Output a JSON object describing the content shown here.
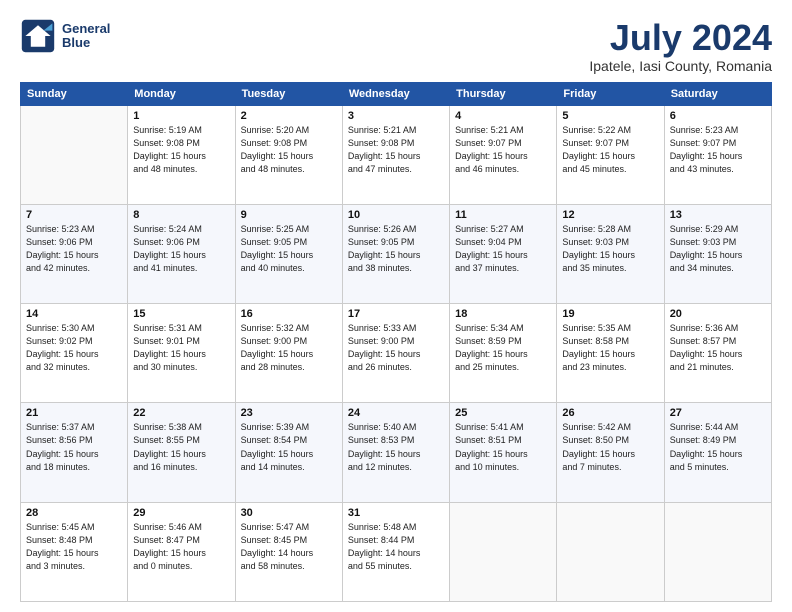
{
  "header": {
    "logo_line1": "General",
    "logo_line2": "Blue",
    "title": "July 2024",
    "subtitle": "Ipatele, Iasi County, Romania"
  },
  "weekdays": [
    "Sunday",
    "Monday",
    "Tuesday",
    "Wednesday",
    "Thursday",
    "Friday",
    "Saturday"
  ],
  "weeks": [
    [
      {
        "day": "",
        "detail": ""
      },
      {
        "day": "1",
        "detail": "Sunrise: 5:19 AM\nSunset: 9:08 PM\nDaylight: 15 hours\nand 48 minutes."
      },
      {
        "day": "2",
        "detail": "Sunrise: 5:20 AM\nSunset: 9:08 PM\nDaylight: 15 hours\nand 48 minutes."
      },
      {
        "day": "3",
        "detail": "Sunrise: 5:21 AM\nSunset: 9:08 PM\nDaylight: 15 hours\nand 47 minutes."
      },
      {
        "day": "4",
        "detail": "Sunrise: 5:21 AM\nSunset: 9:07 PM\nDaylight: 15 hours\nand 46 minutes."
      },
      {
        "day": "5",
        "detail": "Sunrise: 5:22 AM\nSunset: 9:07 PM\nDaylight: 15 hours\nand 45 minutes."
      },
      {
        "day": "6",
        "detail": "Sunrise: 5:23 AM\nSunset: 9:07 PM\nDaylight: 15 hours\nand 43 minutes."
      }
    ],
    [
      {
        "day": "7",
        "detail": "Sunrise: 5:23 AM\nSunset: 9:06 PM\nDaylight: 15 hours\nand 42 minutes."
      },
      {
        "day": "8",
        "detail": "Sunrise: 5:24 AM\nSunset: 9:06 PM\nDaylight: 15 hours\nand 41 minutes."
      },
      {
        "day": "9",
        "detail": "Sunrise: 5:25 AM\nSunset: 9:05 PM\nDaylight: 15 hours\nand 40 minutes."
      },
      {
        "day": "10",
        "detail": "Sunrise: 5:26 AM\nSunset: 9:05 PM\nDaylight: 15 hours\nand 38 minutes."
      },
      {
        "day": "11",
        "detail": "Sunrise: 5:27 AM\nSunset: 9:04 PM\nDaylight: 15 hours\nand 37 minutes."
      },
      {
        "day": "12",
        "detail": "Sunrise: 5:28 AM\nSunset: 9:03 PM\nDaylight: 15 hours\nand 35 minutes."
      },
      {
        "day": "13",
        "detail": "Sunrise: 5:29 AM\nSunset: 9:03 PM\nDaylight: 15 hours\nand 34 minutes."
      }
    ],
    [
      {
        "day": "14",
        "detail": "Sunrise: 5:30 AM\nSunset: 9:02 PM\nDaylight: 15 hours\nand 32 minutes."
      },
      {
        "day": "15",
        "detail": "Sunrise: 5:31 AM\nSunset: 9:01 PM\nDaylight: 15 hours\nand 30 minutes."
      },
      {
        "day": "16",
        "detail": "Sunrise: 5:32 AM\nSunset: 9:00 PM\nDaylight: 15 hours\nand 28 minutes."
      },
      {
        "day": "17",
        "detail": "Sunrise: 5:33 AM\nSunset: 9:00 PM\nDaylight: 15 hours\nand 26 minutes."
      },
      {
        "day": "18",
        "detail": "Sunrise: 5:34 AM\nSunset: 8:59 PM\nDaylight: 15 hours\nand 25 minutes."
      },
      {
        "day": "19",
        "detail": "Sunrise: 5:35 AM\nSunset: 8:58 PM\nDaylight: 15 hours\nand 23 minutes."
      },
      {
        "day": "20",
        "detail": "Sunrise: 5:36 AM\nSunset: 8:57 PM\nDaylight: 15 hours\nand 21 minutes."
      }
    ],
    [
      {
        "day": "21",
        "detail": "Sunrise: 5:37 AM\nSunset: 8:56 PM\nDaylight: 15 hours\nand 18 minutes."
      },
      {
        "day": "22",
        "detail": "Sunrise: 5:38 AM\nSunset: 8:55 PM\nDaylight: 15 hours\nand 16 minutes."
      },
      {
        "day": "23",
        "detail": "Sunrise: 5:39 AM\nSunset: 8:54 PM\nDaylight: 15 hours\nand 14 minutes."
      },
      {
        "day": "24",
        "detail": "Sunrise: 5:40 AM\nSunset: 8:53 PM\nDaylight: 15 hours\nand 12 minutes."
      },
      {
        "day": "25",
        "detail": "Sunrise: 5:41 AM\nSunset: 8:51 PM\nDaylight: 15 hours\nand 10 minutes."
      },
      {
        "day": "26",
        "detail": "Sunrise: 5:42 AM\nSunset: 8:50 PM\nDaylight: 15 hours\nand 7 minutes."
      },
      {
        "day": "27",
        "detail": "Sunrise: 5:44 AM\nSunset: 8:49 PM\nDaylight: 15 hours\nand 5 minutes."
      }
    ],
    [
      {
        "day": "28",
        "detail": "Sunrise: 5:45 AM\nSunset: 8:48 PM\nDaylight: 15 hours\nand 3 minutes."
      },
      {
        "day": "29",
        "detail": "Sunrise: 5:46 AM\nSunset: 8:47 PM\nDaylight: 15 hours\nand 0 minutes."
      },
      {
        "day": "30",
        "detail": "Sunrise: 5:47 AM\nSunset: 8:45 PM\nDaylight: 14 hours\nand 58 minutes."
      },
      {
        "day": "31",
        "detail": "Sunrise: 5:48 AM\nSunset: 8:44 PM\nDaylight: 14 hours\nand 55 minutes."
      },
      {
        "day": "",
        "detail": ""
      },
      {
        "day": "",
        "detail": ""
      },
      {
        "day": "",
        "detail": ""
      }
    ]
  ]
}
